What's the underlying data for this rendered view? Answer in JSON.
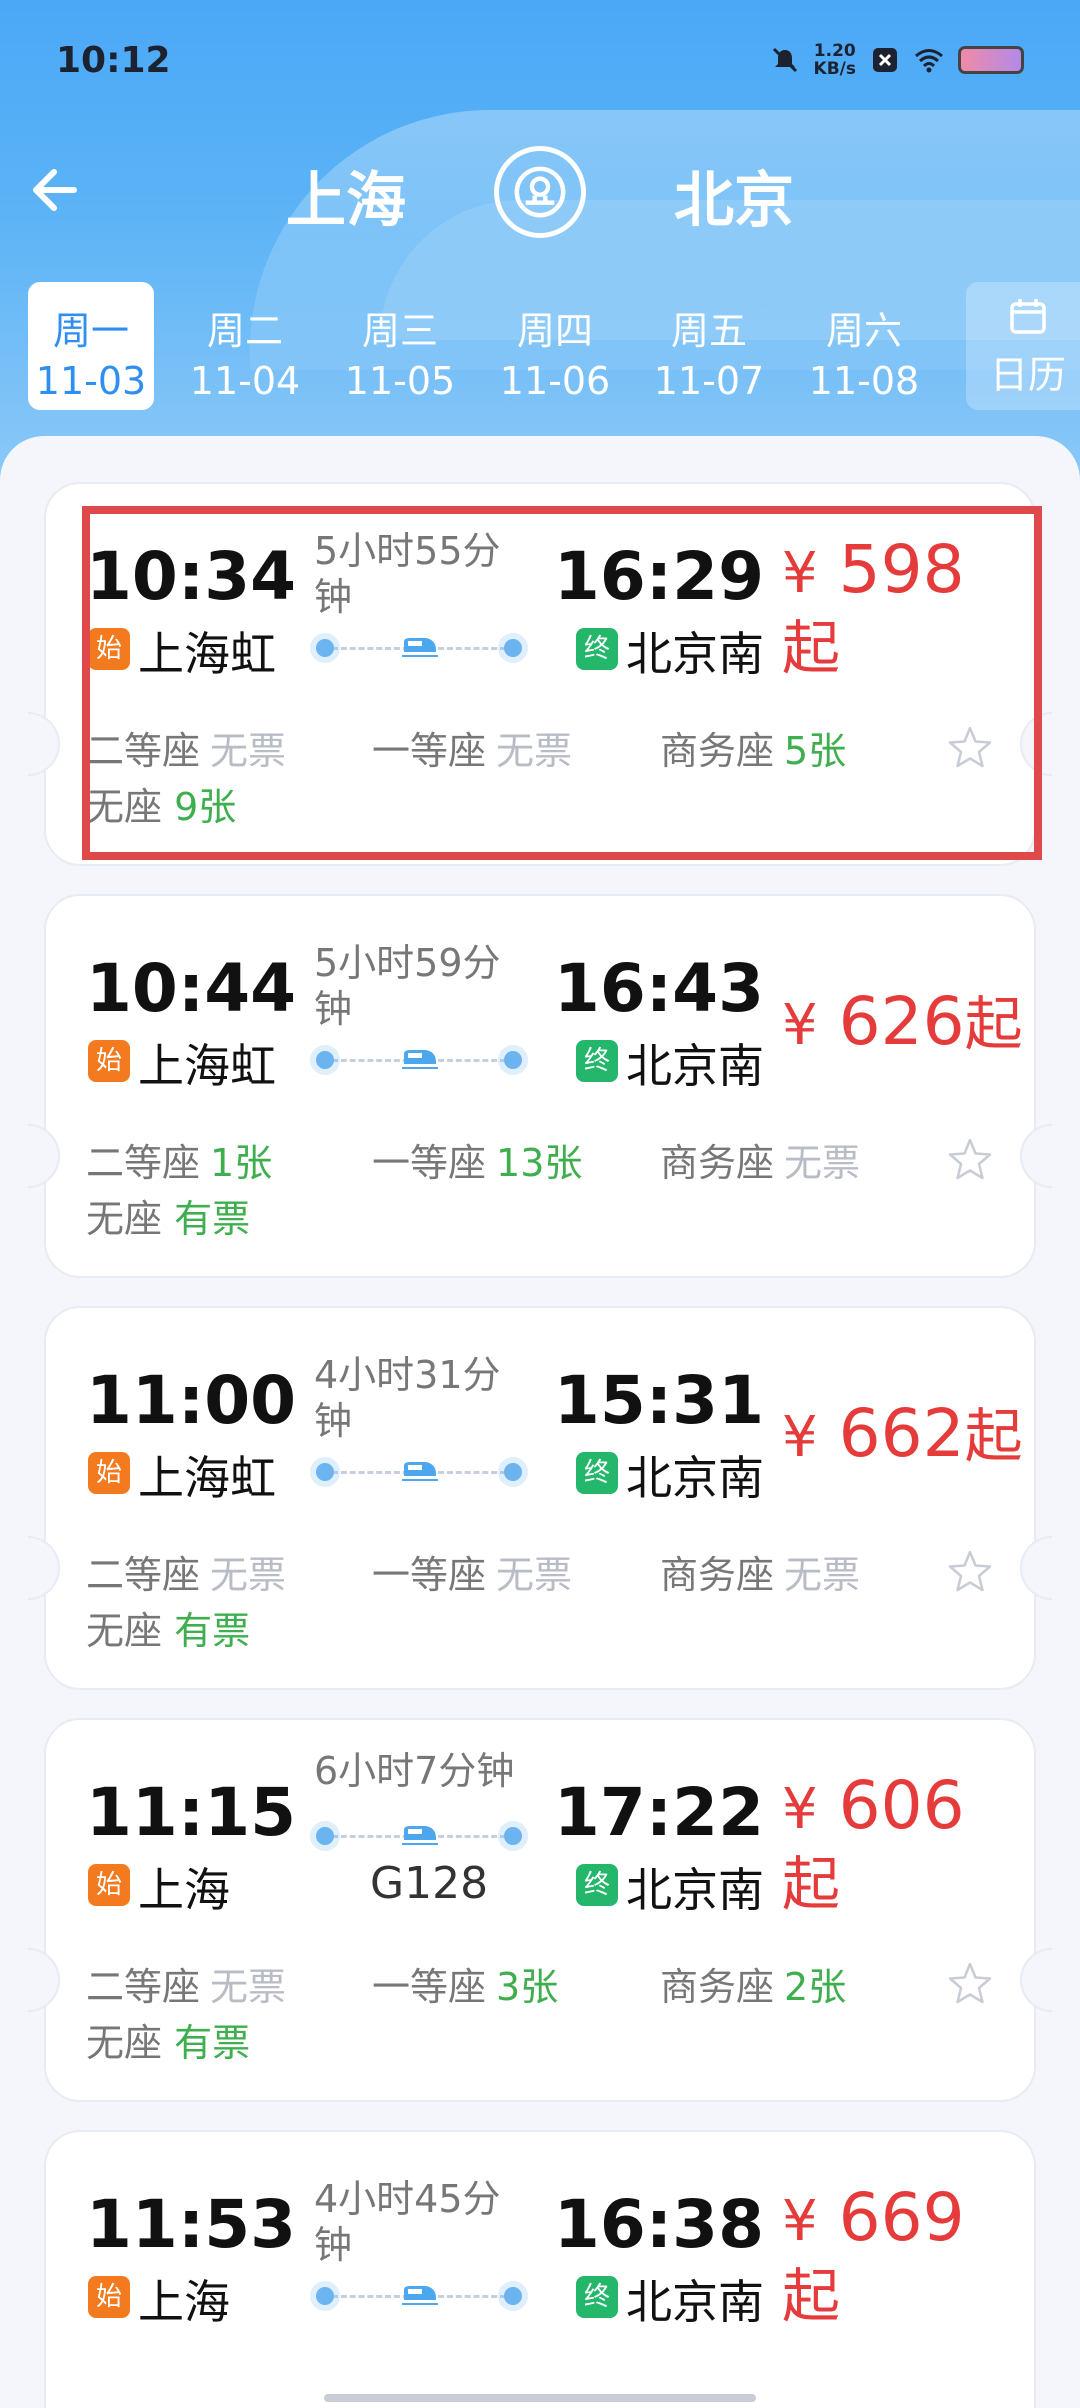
{
  "status_bar": {
    "time": "10:12",
    "speed_value": "1.20",
    "speed_unit": "KB/s"
  },
  "header": {
    "from": "上海",
    "to": "北京"
  },
  "date_tabs": [
    {
      "weekday": "周一",
      "date": "11-03",
      "active": true
    },
    {
      "weekday": "周二",
      "date": "11-04"
    },
    {
      "weekday": "周三",
      "date": "11-05"
    },
    {
      "weekday": "周四",
      "date": "11-06"
    },
    {
      "weekday": "周五",
      "date": "11-07"
    },
    {
      "weekday": "周六",
      "date": "11-08"
    }
  ],
  "calendar": {
    "label": "日历"
  },
  "badges": {
    "start": "始",
    "end": "终"
  },
  "currency": "¥",
  "price_suffix": "起",
  "trains": [
    {
      "dep_time": "10:34",
      "arr_time": "16:29",
      "duration": "5小时55分钟",
      "dep_station": "上海虹",
      "arr_station": "北京南",
      "price": "598",
      "seats": {
        "second": "二等座",
        "second_val": "无票",
        "first": "一等座",
        "first_val": "无票",
        "business": "商务座",
        "business_val": "5张",
        "standing": "无座",
        "standing_val": "9张"
      }
    },
    {
      "dep_time": "10:44",
      "arr_time": "16:43",
      "duration": "5小时59分钟",
      "dep_station": "上海虹",
      "arr_station": "北京南",
      "price": "626",
      "seats": {
        "second": "二等座",
        "second_val": "1张",
        "first": "一等座",
        "first_val": "13张",
        "business": "商务座",
        "business_val": "无票",
        "standing": "无座",
        "standing_val": "有票"
      }
    },
    {
      "dep_time": "11:00",
      "arr_time": "15:31",
      "duration": "4小时31分钟",
      "dep_station": "上海虹",
      "arr_station": "北京南",
      "price": "662",
      "seats": {
        "second": "二等座",
        "second_val": "无票",
        "first": "一等座",
        "first_val": "无票",
        "business": "商务座",
        "business_val": "无票",
        "standing": "无座",
        "standing_val": "有票"
      }
    },
    {
      "dep_time": "11:15",
      "arr_time": "17:22",
      "duration": "6小时7分钟",
      "train_no": "G128",
      "dep_station": "上海",
      "arr_station": "北京南",
      "price": "606",
      "seats": {
        "second": "二等座",
        "second_val": "无票",
        "first": "一等座",
        "first_val": "3张",
        "business": "商务座",
        "business_val": "2张",
        "standing": "无座",
        "standing_val": "有票"
      }
    },
    {
      "dep_time": "11:53",
      "arr_time": "16:38",
      "duration": "4小时45分钟",
      "dep_station": "上海",
      "arr_station": "北京南",
      "price": "669"
    }
  ],
  "colors": {
    "accent_blue": "#4ba8f7",
    "price_red": "#e53b3b",
    "available_green": "#3fae4f",
    "none_gray": "#b8bcc5",
    "highlight_red": "#e04949"
  },
  "icons": [
    "back-arrow-icon",
    "swap-station-icon",
    "calendar-icon",
    "train-icon",
    "star-icon",
    "wifi-icon",
    "mute-icon",
    "battery-icon"
  ]
}
